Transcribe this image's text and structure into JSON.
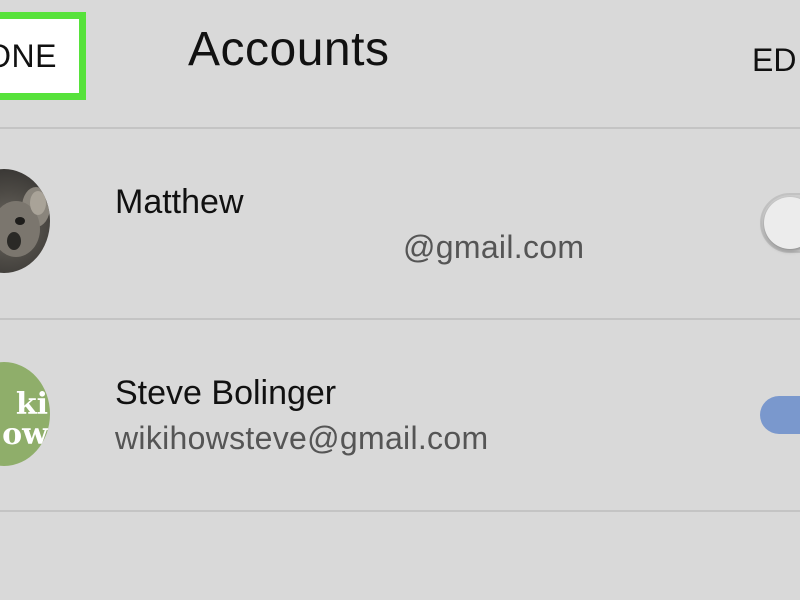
{
  "header": {
    "done_label": "ONE",
    "title": "Accounts",
    "edit_label": "ED"
  },
  "accounts": [
    {
      "name": "Matthew",
      "email": "@gmail.com",
      "avatar": "koala-photo",
      "toggle_on": false
    },
    {
      "name": "Steve Bolinger",
      "email": "wikihowsteve@gmail.com",
      "avatar": "wikihow-logo",
      "avatar_text_top": "ki",
      "avatar_text_bottom": "ow",
      "toggle_on": true
    }
  ],
  "colors": {
    "background": "#d9d9d9",
    "highlight": "#57e23b",
    "toggle_on": "#7a98cd",
    "divider": "#c4c4c4"
  }
}
